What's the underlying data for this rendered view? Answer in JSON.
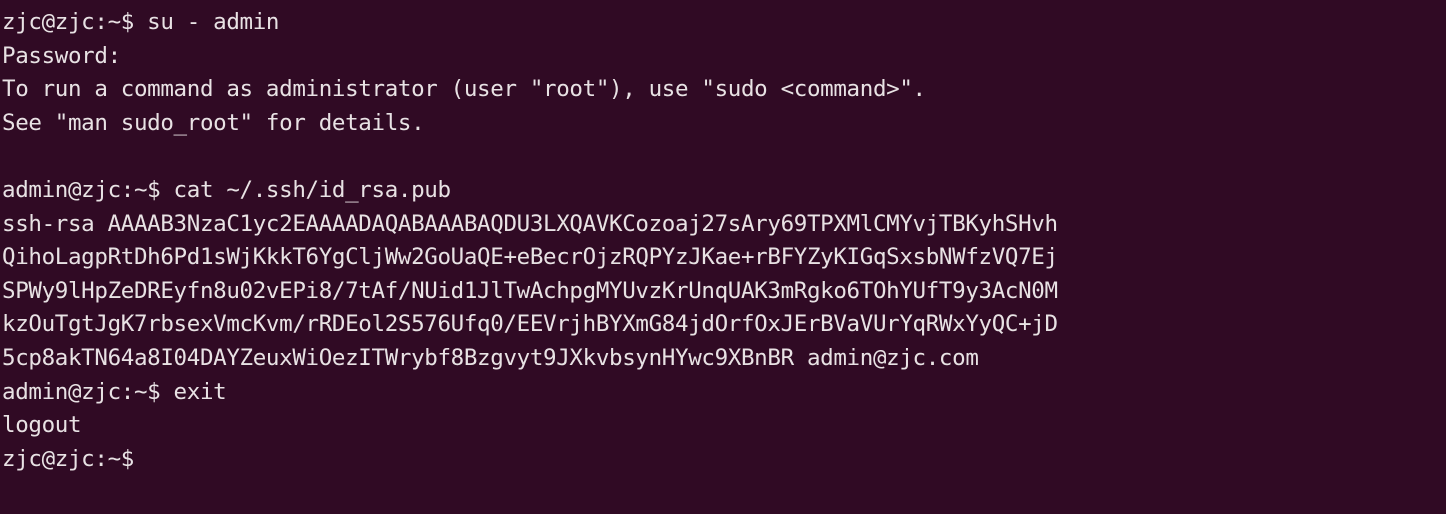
{
  "terminal": {
    "background_color": "#300a24",
    "foreground_color": "#e8e2e4",
    "lines": [
      {
        "id": "prompt-su",
        "text": "zjc@zjc:~$ su - admin"
      },
      {
        "id": "password-prompt",
        "text": "Password:"
      },
      {
        "id": "sudo-notice-1",
        "text": "To run a command as administrator (user \"root\"), use \"sudo <command>\"."
      },
      {
        "id": "sudo-notice-2",
        "text": "See \"man sudo_root\" for details."
      },
      {
        "id": "blank-1",
        "text": ""
      },
      {
        "id": "prompt-cat",
        "text": "admin@zjc:~$ cat ~/.ssh/id_rsa.pub"
      },
      {
        "id": "ssh-key-line-1",
        "text": "ssh-rsa AAAAB3NzaC1yc2EAAAADAQABAAABAQDU3LXQAVKCozoaj27sAry69TPXMlCMYvjTBKyhSHvh"
      },
      {
        "id": "ssh-key-line-2",
        "text": "QihoLagpRtDh6Pd1sWjKkkT6YgCljWw2GoUaQE+eBecrOjzRQPYzJKae+rBFYZyKIGqSxsbNWfzVQ7Ej"
      },
      {
        "id": "ssh-key-line-3",
        "text": "SPWy9lHpZeDREyfn8u02vEPi8/7tAf/NUid1JlTwAchpgMYUvzKrUnqUAK3mRgko6TOhYUfT9y3AcN0M"
      },
      {
        "id": "ssh-key-line-4",
        "text": "kzOuTgtJgK7rbsexVmcKvm/rRDEol2S576Ufq0/EEVrjhBYXmG84jdOrfOxJErBVaVUrYqRWxYyQC+jD"
      },
      {
        "id": "ssh-key-line-5",
        "text": "5cp8akTN64a8I04DAYZeuxWiOezITWrybf8Bzgvyt9JXkvbsynHYwc9XBnBR admin@zjc.com"
      },
      {
        "id": "prompt-exit",
        "text": "admin@zjc:~$ exit"
      },
      {
        "id": "logout-output",
        "text": "logout"
      },
      {
        "id": "prompt-final",
        "text": "zjc@zjc:~$"
      }
    ]
  }
}
